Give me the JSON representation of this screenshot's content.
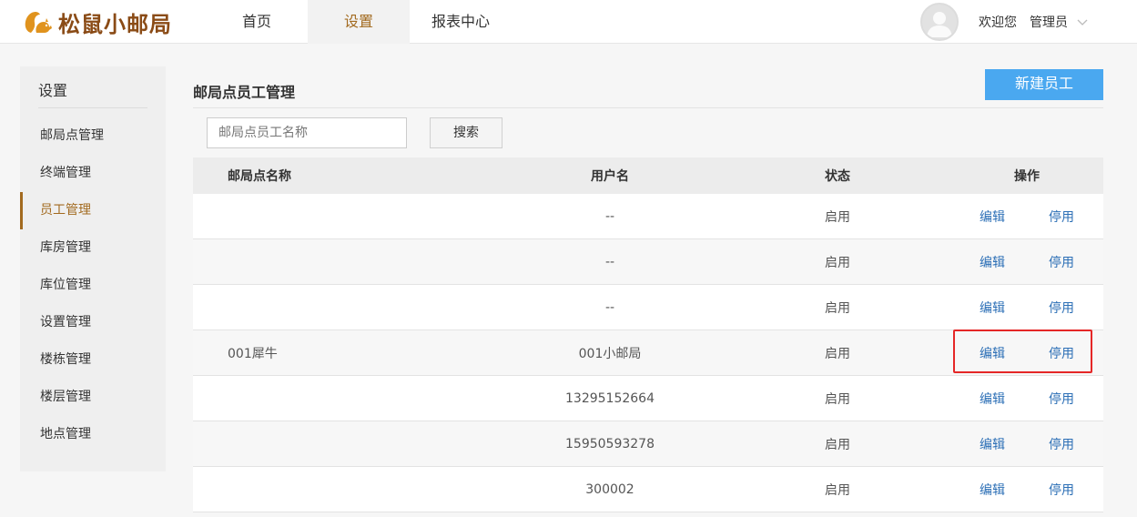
{
  "header": {
    "logo_text": "松鼠小邮局",
    "nav": [
      {
        "label": "首页"
      },
      {
        "label": "设置"
      },
      {
        "label": "报表中心"
      }
    ],
    "welcome": "欢迎您",
    "username": "管理员"
  },
  "sidebar": {
    "title": "设置",
    "items": [
      {
        "label": "邮局点管理"
      },
      {
        "label": "终端管理"
      },
      {
        "label": "员工管理"
      },
      {
        "label": "库房管理"
      },
      {
        "label": "库位管理"
      },
      {
        "label": "设置管理"
      },
      {
        "label": "楼栋管理"
      },
      {
        "label": "楼层管理"
      },
      {
        "label": "地点管理"
      }
    ]
  },
  "main": {
    "title": "邮局点员工管理",
    "new_button": "新建员工",
    "search_placeholder": "邮局点员工名称",
    "search_button": "搜索",
    "columns": [
      "邮局点名称",
      "用户名",
      "状态",
      "操作"
    ],
    "rows": [
      {
        "name": "",
        "user": "--",
        "status": "启用",
        "edit": "编辑",
        "stop": "停用"
      },
      {
        "name": "",
        "user": "--",
        "status": "启用",
        "edit": "编辑",
        "stop": "停用"
      },
      {
        "name": "",
        "user": "--",
        "status": "启用",
        "edit": "编辑",
        "stop": "停用"
      },
      {
        "name": "001犀牛",
        "user": "001小邮局",
        "status": "启用",
        "edit": "编辑",
        "stop": "停用"
      },
      {
        "name": "",
        "user": "13295152664",
        "status": "启用",
        "edit": "编辑",
        "stop": "停用"
      },
      {
        "name": "",
        "user": "15950593278",
        "status": "启用",
        "edit": "编辑",
        "stop": "停用"
      },
      {
        "name": "",
        "user": "300002",
        "status": "启用",
        "edit": "编辑",
        "stop": "停用"
      }
    ]
  },
  "colors": {
    "brand": "#8a4b16",
    "accent": "#a26a1f",
    "primary_button": "#4aa8f0",
    "link": "#2c6fb6",
    "highlight": "#e52727"
  },
  "icons": {
    "logo": "squirrel-icon",
    "avatar": "user-avatar-icon",
    "caret": "chevron-down-icon"
  }
}
